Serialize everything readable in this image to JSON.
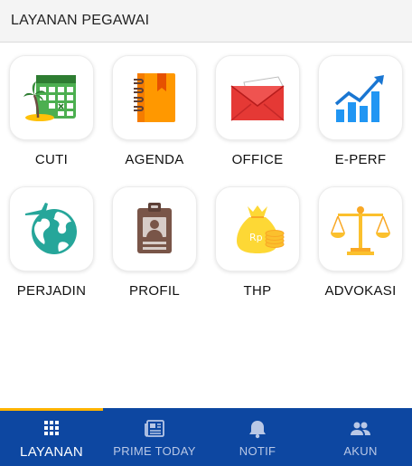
{
  "header": {
    "title": "LAYANAN PEGAWAI"
  },
  "tiles": [
    {
      "label": "CUTI",
      "icon": "calendar-beach-icon"
    },
    {
      "label": "AGENDA",
      "icon": "agenda-book-icon"
    },
    {
      "label": "OFFICE",
      "icon": "mail-envelope-icon"
    },
    {
      "label": "E-PERF",
      "icon": "bar-chart-growth-icon"
    },
    {
      "label": "PERJADIN",
      "icon": "globe-plane-icon"
    },
    {
      "label": "PROFIL",
      "icon": "id-badge-icon"
    },
    {
      "label": "THP",
      "icon": "money-bag-icon"
    },
    {
      "label": "ADVOKASI",
      "icon": "scales-justice-icon"
    }
  ],
  "bottom_nav": {
    "items": [
      {
        "label": "LAYANAN",
        "icon": "grid-icon",
        "active": true
      },
      {
        "label": "PRIME TODAY",
        "icon": "newspaper-icon",
        "active": false
      },
      {
        "label": "NOTIF",
        "icon": "bell-icon",
        "active": false
      },
      {
        "label": "AKUN",
        "icon": "people-icon",
        "active": false
      }
    ]
  },
  "colors": {
    "nav_background": "#0d47a1",
    "nav_active_indicator": "#ffb300",
    "header_background": "#f4f4f4"
  }
}
